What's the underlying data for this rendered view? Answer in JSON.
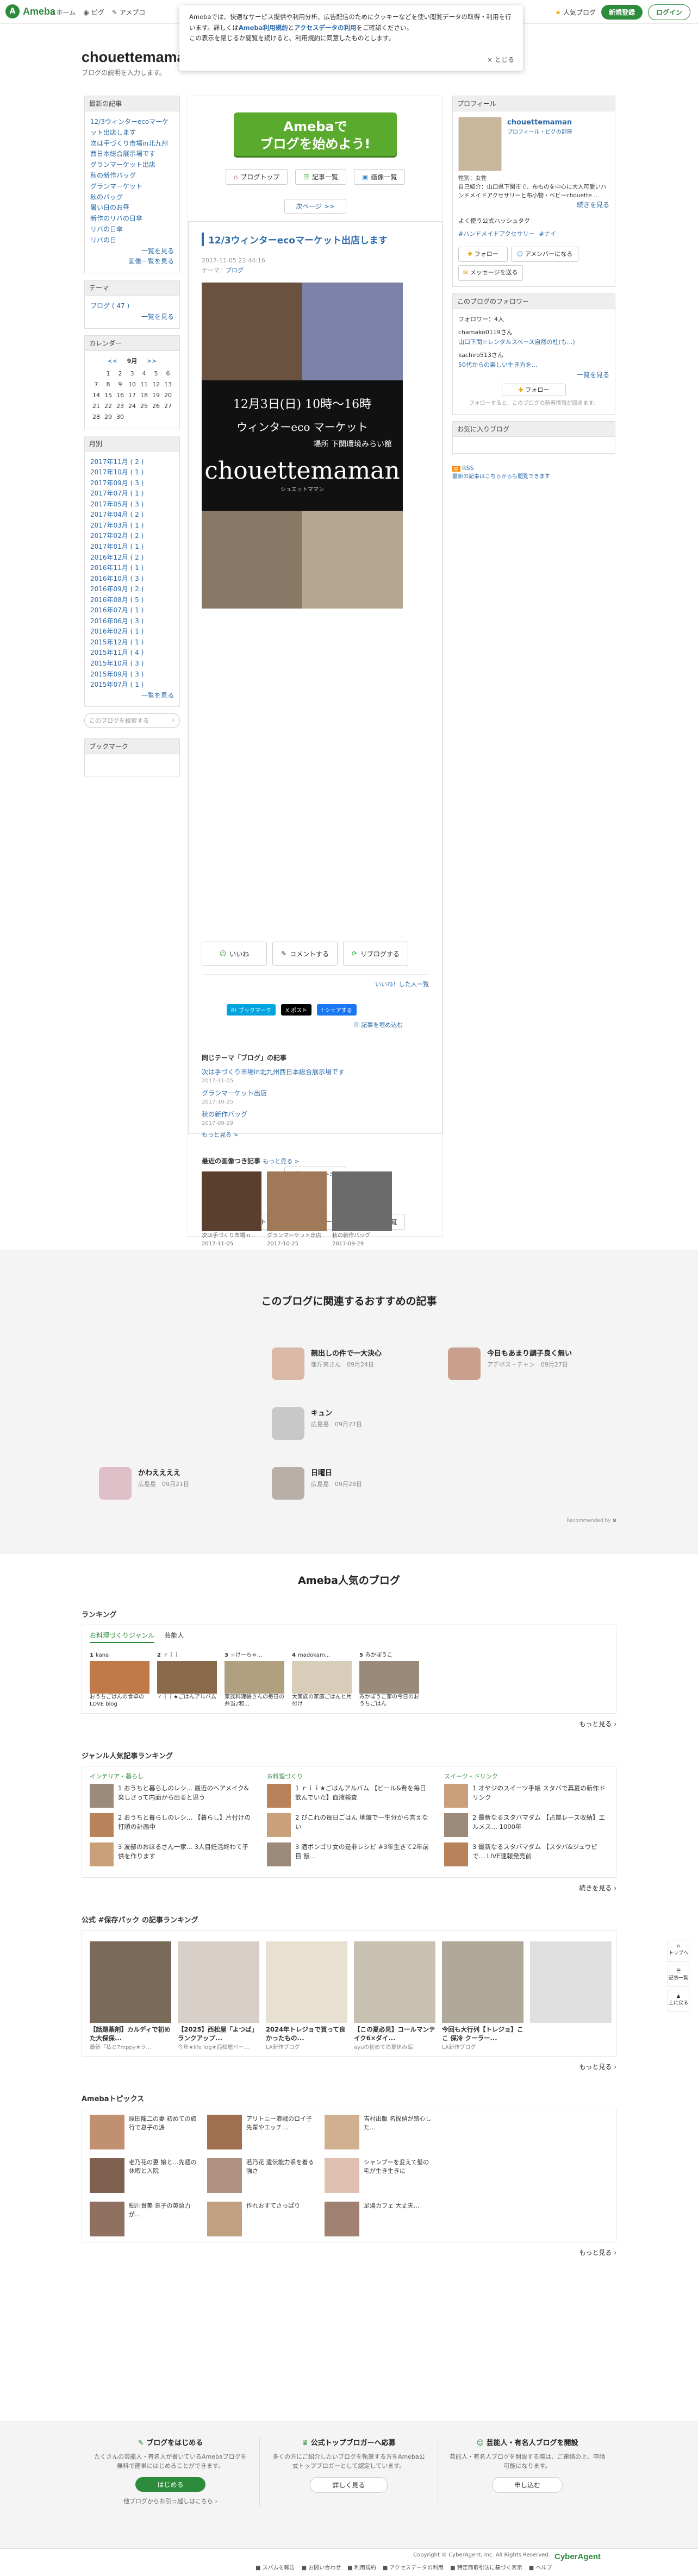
{
  "topbar": {
    "logo": "Ameba",
    "nav": [
      "ホーム",
      "ピグ",
      "アメブロ"
    ],
    "popular": "人気ブログ",
    "signup": "新規登録",
    "login": "ログイン"
  },
  "cookie": {
    "text1": "Amebaでは、快適なサービス提供や利用分析、広告配信のためにクッキーなどを使い閲覧データの取得・利用を行います。詳しくは",
    "link1": "Ameba利用規約",
    "and": "と",
    "link2": "アクセスデータの利用",
    "text2": "をご確認ください。",
    "text3": "この表示を閉じるか閲覧を続けると、利用規約に同意したものとします。",
    "close": "× とじる"
  },
  "blog": {
    "title": "chouettemaman",
    "subtitle": "ブログの説明を入力します。"
  },
  "left": {
    "recent_title": "最新の記事",
    "recent": [
      "12/3ウィンターecoマーケット出店します",
      "次は手づくり市場in北九州西日本総合展示場です",
      "グランマーケット出店",
      "秋の新作バッグ",
      "グランマーケット",
      "秋のバッグ",
      "暑い日のお昼",
      "新作のリバの日傘",
      "リバの日傘",
      "リバの日"
    ],
    "recent_more": "一覧を見る",
    "recent_more2": "画像一覧を見る",
    "theme_title": "テーマ",
    "theme_item": "ブログ ( 47 )",
    "theme_more": "一覧を見る",
    "cal_title": "カレンダー",
    "cal_prev": "<<",
    "cal_month": "9月",
    "cal_next": ">>",
    "cal_rows": [
      [
        "",
        "1",
        "2",
        "3",
        "4",
        "5",
        "6"
      ],
      [
        "7",
        "8",
        "9",
        "10",
        "11",
        "12",
        "13"
      ],
      [
        "14",
        "15",
        "16",
        "17",
        "18",
        "19",
        "20"
      ],
      [
        "21",
        "22",
        "23",
        "24",
        "25",
        "26",
        "27"
      ],
      [
        "28",
        "29",
        "30",
        "",
        "",
        "",
        ""
      ]
    ],
    "archive_title": "月別",
    "archive": [
      "2017年11月 ( 2 )",
      "2017年10月 ( 1 )",
      "2017年09月 ( 3 )",
      "2017年07月 ( 1 )",
      "2017年05月 ( 3 )",
      "2017年04月 ( 2 )",
      "2017年03月 ( 1 )",
      "2017年02月 ( 2 )",
      "2017年01月 ( 1 )",
      "2016年12月 ( 2 )",
      "2016年11月 ( 1 )",
      "2016年10月 ( 3 )",
      "2016年09月 ( 2 )",
      "2016年08月 ( 5 )",
      "2016年07月 ( 1 )",
      "2016年06月 ( 3 )",
      "2016年02月 ( 1 )",
      "2015年12月 ( 1 )",
      "2015年11月 ( 4 )",
      "2015年10月 ( 3 )",
      "2015年09月 ( 3 )",
      "2015年07月 ( 1 )"
    ],
    "archive_more": "一覧を見る",
    "search_placeholder": "このブログを検索する",
    "bookmark_title": "ブックマーク"
  },
  "main": {
    "banner_line1": "Amebaで",
    "banner_line2": "ブログを始めよう!",
    "btn_top": "ブログトップ",
    "btn_list": "記事一覧",
    "btn_images": "画像一覧",
    "next": "次ページ >>",
    "article_title": "12/3ウィンターecoマーケット出店します",
    "article_date": "2017-11-05 22:44:16",
    "article_theme_label": "テーマ：",
    "article_theme": "ブログ",
    "flyer_date": "12月3日(日) 10時〜16時",
    "flyer_event": "ウィンターeco マーケット",
    "flyer_place": "場所 下関環境みらい館",
    "flyer_brand": "chouettemaman",
    "flyer_brand_sub": "シュエットママン",
    "like": "いいね",
    "comment": "コメントする",
    "reblog": "リブログする",
    "like_list": "いいね！した人一覧",
    "share_hatena": "B! ブックマーク",
    "share_x": "X ポスト",
    "share_fb": "f シェアする",
    "embed": "記事を埋め込む",
    "same_theme_title": "同じテーマ「ブログ」の記事",
    "same_theme": [
      {
        "title": "次は手づくり市場in北九州西日本総合展示場です",
        "date": "2017-11-05"
      },
      {
        "title": "グランマーケット出店",
        "date": "2017-10-25"
      },
      {
        "title": "秋の新作バッグ",
        "date": "2017-09-29"
      }
    ],
    "same_more": "もっと見る >",
    "recent_images_title": "最近の画像つき記事",
    "recent_images_more": "もっと見る >",
    "thumbs": [
      {
        "cap": "次は手づくり市場in...",
        "date": "2017-11-05"
      },
      {
        "cap": "グランマーケット出店",
        "date": "2017-10-25"
      },
      {
        "cap": "秋の新作バッグ",
        "date": "2017-09-29"
      }
    ]
  },
  "right": {
    "profile_title": "プロフィール",
    "profile_name": "chouettemaman",
    "profile_links": "プロフィール・ピグの部屋",
    "profile_text": "性別：女性\n自己紹介：山口県下関市で、布ものを中心に大人可愛いハンドメイドアクセサリーと布小物・ベビーchouette ...",
    "profile_more": "続きを見る",
    "genre_title": "よく使う公式ハッシュタグ",
    "tags": [
      "#ハンドメイドアクセサリー",
      "#ナイ"
    ],
    "follow": "フォロー",
    "member": "アメンバーになる",
    "message": "メッセージを送る",
    "follower_title": "このブログのフォロワー",
    "follower_count": "フォロワー：",
    "follower_count_val": "4",
    "followers": [
      {
        "name": "chamako0119さん",
        "post": "山口下関☆レンタルスペース自然の杜(も...)"
      },
      {
        "name": "kachiro513さん",
        "post": "50代からの楽しい生き方を..."
      }
    ],
    "follower_more": "一覧を見る",
    "follow2": "フォロー",
    "follow_note": "フォローすると、このブログの新着情報が届きます。",
    "fav_title": "お気に入りブログ",
    "rss": "RSS",
    "rss_note": "最新の記事はこちらからも閲覧できます"
  },
  "reco": {
    "title": "このブログに関連するおすすめの記事",
    "items": [
      {
        "title": "親出しの件で一大決心",
        "author": "亜斤来さん",
        "date": "09月24日"
      },
      {
        "title": "今日もあまり調子良く無い",
        "author": "アデボス・チャン",
        "date": "09月27日"
      },
      {
        "title": "キュン",
        "author": "広島島",
        "date": "09月27日"
      },
      {
        "title": "かわええええ",
        "author": "広島島",
        "date": "09月21日"
      },
      {
        "title": "日曜日",
        "author": "広島島",
        "date": "09月28日"
      }
    ],
    "powered": "Recommended by"
  },
  "popular": {
    "title": "Ameba人気のブログ",
    "ranking_title": "ランキング",
    "tabs": [
      "お料理づくりジャンル",
      "芸能人"
    ],
    "ranks": [
      {
        "name": "kana",
        "desc": "おうちごはんの食卓のLOVE blog"
      },
      {
        "name": "ｒｉｉ",
        "desc": "ｒｉｉ★ごはんアルバム"
      },
      {
        "name": "☆けーちゃ...",
        "desc": "家族料理帳さんの毎日の弁当♪和..."
      },
      {
        "name": "madokam...",
        "desc": "大家族の家庭ごはんと片付け"
      },
      {
        "name": "みかぼうこ",
        "desc": "みかぼうこ家の今日のおうちごはん"
      }
    ],
    "rank_more": "もっと見る",
    "genre_title": "ジャンル人気記事ランキング",
    "genres": [
      {
        "h": "インテリア・暮らし",
        "items": [
          "おうちと暮らしのレシ... 最近のヘアメイク&楽しさって内面から出ると思う",
          "おうちと暮らしのレシ... 【暮らし】片付けの打順の計画中",
          "波部のおほるさん一家... 3人目妊活終わて子供を作ります"
        ]
      },
      {
        "h": "お料理づくり",
        "items": [
          "ｒｉｉ★ごはんアルバム 【ビール&肴を毎日飲んでいた】血液検査",
          "ぴこれの毎日ごはん 地盤で一生分から言えない",
          "酒ボンゴリ女の是非レシピ #3年生きて2年前目 飯…"
        ]
      },
      {
        "h": "スイーツ・ドリンク",
        "items": [
          "オヤジのスイーツ手帳 スタバで真夏の新作ドリンク",
          "最新なるスタバマダム 【占罠レース収納】エルメス… 1000年",
          "最新なるスタバマダム 【スタバ&ジュウピで… LIVE速報発売前"
        ]
      }
    ],
    "genre_more": "続きを見る",
    "pack_title": "公式 #保存パック の記事ランキング",
    "packs": [
      {
        "t": "【話題薬剤】カルディで初めた大保保...",
        "s": "最新「私と7mppy★ラ..."
      },
      {
        "t": "【2025】西松屋「よつば」ランクアップ...",
        "s": "今年★life log★西松屋バー..."
      },
      {
        "t": "2024年トレジョで買って良かったもの...",
        "s": "LA新作ブログ"
      },
      {
        "t": "【この夏必見】コールマンテイク6×ダイ...",
        "s": "ayuの初めての夏休み編"
      },
      {
        "t": "今回も大行列【トレジョ】ここ 保冷 クーラー...",
        "s": "LA新作ブログ"
      },
      {
        "t": "",
        "s": ""
      }
    ],
    "pack_more": "もっと見る",
    "topics_title": "Amebaトピックス",
    "topics": [
      "原田龍二の妻 初めての旅行で息子の涙",
      "アリトニー浪戦のロイ子先輩やエッチ…",
      "吉村出版 名探偵が感心した…",
      "老乃花の妻 娘と…先週の休暇と入院",
      "若乃花 遺伝能力系を着る強さ",
      "シャンプーを変えて髪の毛が生き生きに",
      "細川貴美 息子の英語力が…",
      "作れおすてさっぱり",
      "足湯カフェ 大丈夫…"
    ],
    "topics_more": "もっと見る"
  },
  "bottom": {
    "c1_h": "ブログをはじめる",
    "c1_d": "たくさんの芸能人・有名人が書いているAmebaブログを無料で簡単にはじめることができます。",
    "c1_btn": "はじめる",
    "c1_link": "他ブログからお引っ越しはこちら",
    "c2_h": "公式トップブロガーへ応募",
    "c2_d": "多くの方にご紹介したいブログを執筆する方をAmeba公式トップブロガーとして認定しています。",
    "c2_btn": "詳しく見る",
    "c3_h": "芸能人・有名人ブログを開設",
    "c3_d": "芸能人・有名人ブログを開設する際は、ご連絡の上、申請可能になります。",
    "c3_btn": "申し込む"
  },
  "footer": {
    "copy": "Copyright © CyberAgent, Inc. All Rights Reserved.",
    "links": [
      "スパムを報告",
      "お問い合わせ",
      "利用規約",
      "アクセスデータの利用",
      "特定商取引法に基づく表示",
      "ヘルプ"
    ],
    "brand": "CyberAgent"
  },
  "float": [
    "トップへ",
    "記事一覧",
    "上に戻る"
  ]
}
